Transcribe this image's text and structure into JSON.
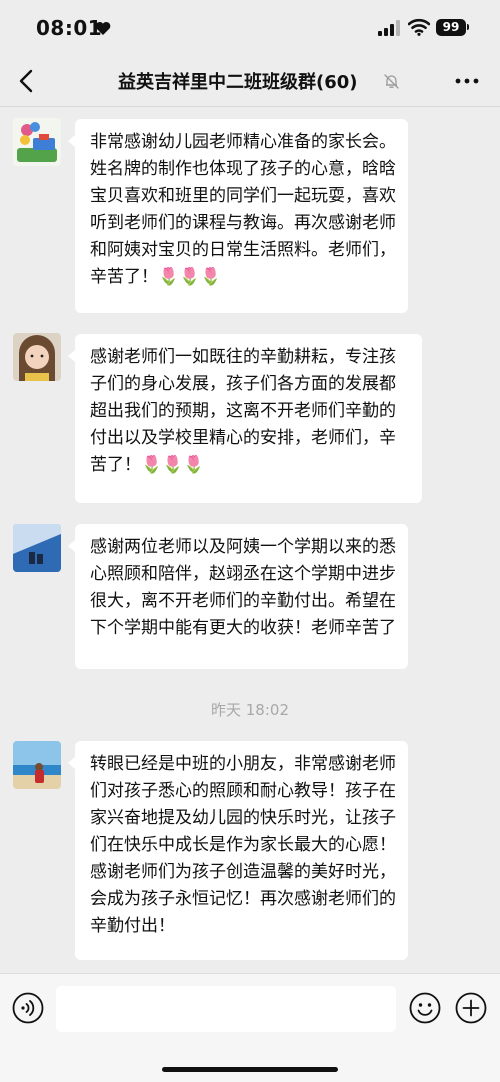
{
  "status_bar": {
    "time": "08:01",
    "battery": "99"
  },
  "header": {
    "title": "益英吉祥里中二班班级群(60)"
  },
  "messages": [
    {
      "text": "非常感谢幼儿园老师精心准备的家长会。姓名牌的制作也体现了孩子的心意，晗晗宝贝喜欢和班里的同学们一起玩耍，喜欢听到老师们的课程与教诲。再次感谢老师和阿姨对宝贝的日常生活照料。老师们，辛苦了！🌷🌷🌷"
    },
    {
      "text": "感谢老师们一如既往的辛勤耕耘，专注孩子们的身心发展，孩子们各方面的发展都超出我们的预期，这离不开老师们辛勤的付出以及学校里精心的安排，老师们，辛苦了！🌷🌷🌷"
    },
    {
      "text": "感谢两位老师以及阿姨一个学期以来的悉心照顾和陪伴，赵翊丞在这个学期中进步很大，离不开老师们的辛勤付出。希望在下个学期中能有更大的收获！老师辛苦了"
    },
    {
      "text": "转眼已经是中班的小朋友，非常感谢老师们对孩子悉心的照顾和耐心教导！孩子在家兴奋地提及幼儿园的快乐时光，让孩子们在快乐中成长是作为家长最大的心愿！感谢老师们为孩子创造温馨的美好时光，会成为孩子永恒记忆！再次感谢老师们的辛勤付出！"
    }
  ],
  "timestamp": "昨天 18:02",
  "input": {
    "value": ""
  }
}
